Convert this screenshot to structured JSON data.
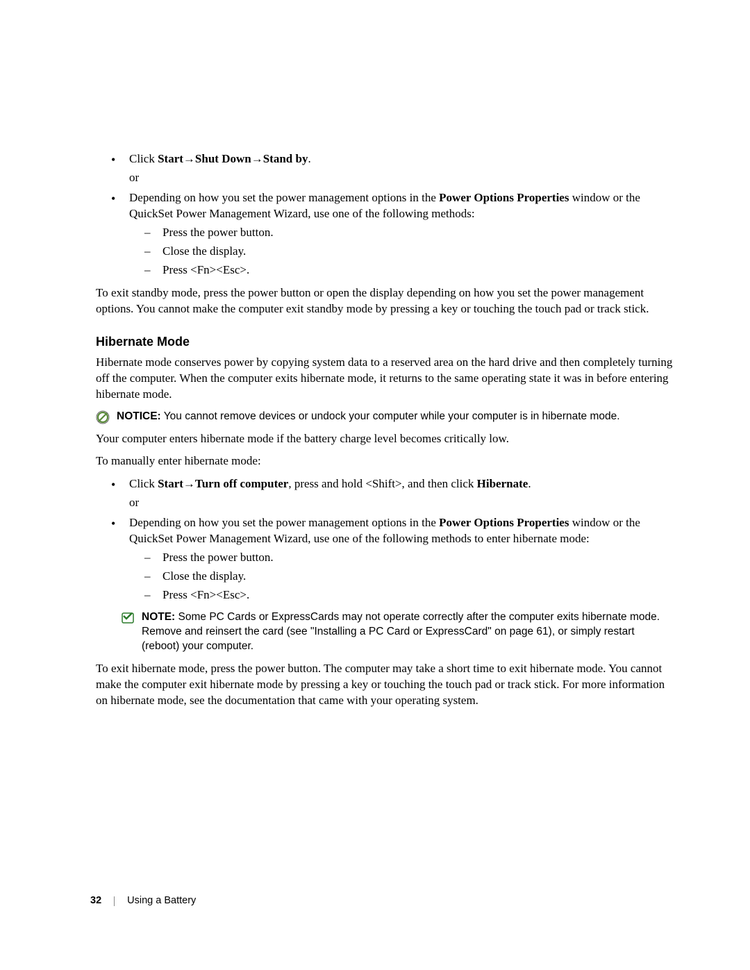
{
  "standby": {
    "item1": {
      "click": "Click ",
      "b1": "Start",
      "arrow1": "→",
      "b2": "Shut Down",
      "arrow2": "→",
      "b3": "Stand by",
      "period": ".",
      "or": "or"
    },
    "item2": {
      "pre": "Depending on how you set the power management options in the ",
      "bold": "Power Options Properties",
      "post": " window or the QuickSet Power Management Wizard, use one of the following methods:",
      "d1": "Press the power button.",
      "d2": "Close the display.",
      "d3": "Press <Fn><Esc>."
    },
    "exit": "To exit standby mode, press the power button or open the display depending on how you set the power management options. You cannot make the computer exit standby mode by pressing a key or touching the touch pad or track stick."
  },
  "hibernate": {
    "heading": "Hibernate Mode",
    "intro": "Hibernate mode conserves power by copying system data to a reserved area on the hard drive and then completely turning off the computer. When the computer exits hibernate mode, it returns to the same operating state it was in before entering hibernate mode.",
    "notice": {
      "label": "NOTICE:",
      "text": " You cannot remove devices or undock your computer while your computer is in hibernate mode."
    },
    "enters": "Your computer enters hibernate mode if the battery charge level becomes critically low.",
    "manual": "To manually enter hibernate mode:",
    "item1": {
      "click": "Click ",
      "b1": "Start",
      "arrow1": "→",
      "b2": "Turn off computer",
      "mid": ", press and hold <Shift>, and then click ",
      "b3": "Hibernate",
      "period": ".",
      "or": "or"
    },
    "item2": {
      "pre": "Depending on how you set the power management options in the ",
      "bold": "Power Options Properties",
      "post": " window or the QuickSet Power Management Wizard, use one of the following methods to enter hibernate mode:",
      "d1": "Press the power button.",
      "d2": "Close the display.",
      "d3": "Press <Fn><Esc>."
    },
    "note": {
      "label": "NOTE:",
      "text": " Some PC Cards or ExpressCards may not operate correctly after the computer exits hibernate mode. Remove and reinsert the card (see \"Installing a PC Card or ExpressCard\" on page 61), or simply restart (reboot) your computer."
    },
    "exit": "To exit hibernate mode, press the power button. The computer may take a short time to exit hibernate mode. You cannot make the computer exit hibernate mode by pressing a key or touching the touch pad or track stick. For more information on hibernate mode, see the documentation that came with your operating system."
  },
  "footer": {
    "page": "32",
    "section": "Using a Battery"
  }
}
